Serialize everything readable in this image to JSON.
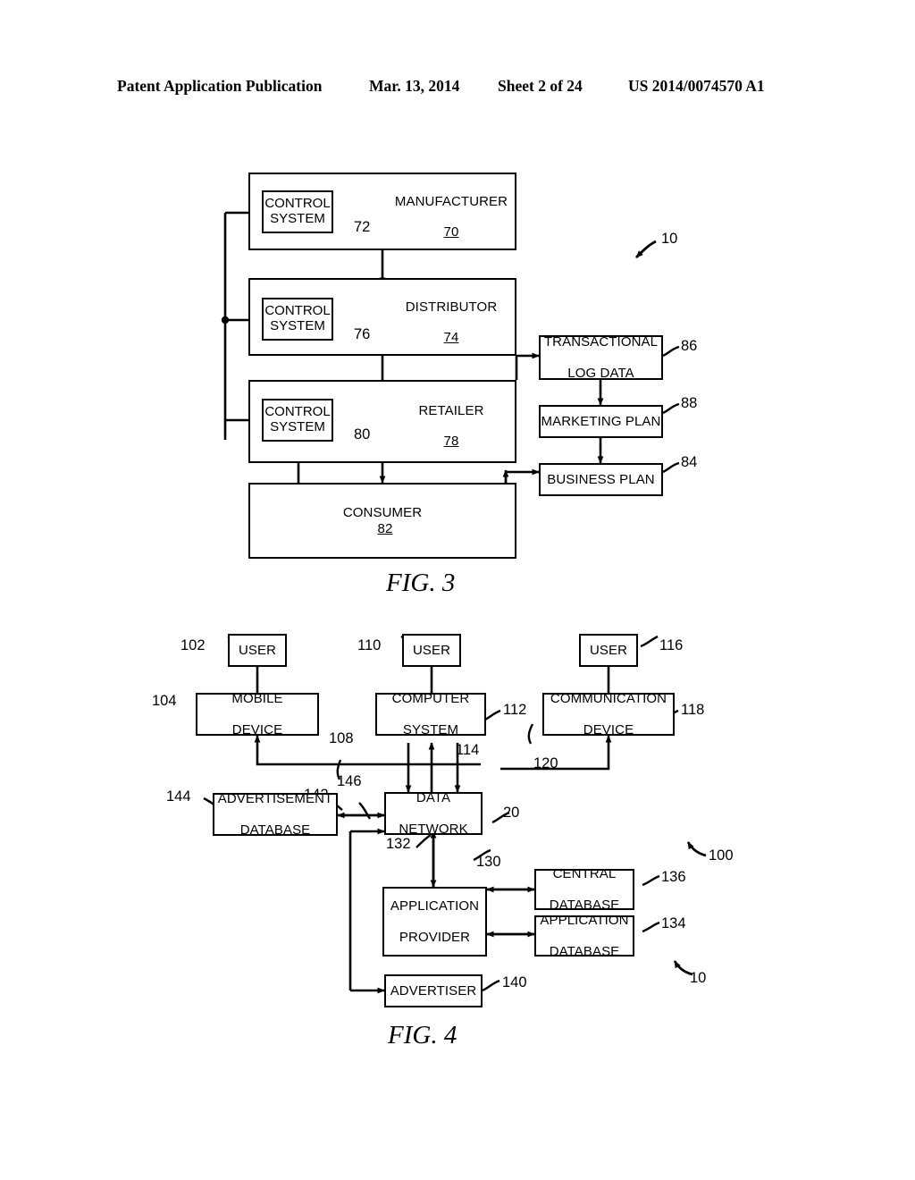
{
  "header": {
    "publication": "Patent Application Publication",
    "date": "Mar. 13, 2014",
    "sheet": "Sheet 2 of 24",
    "number": "US 2014/0074570 A1"
  },
  "fig3": {
    "caption": "FIG. 3",
    "system_ref": "10",
    "nodes": [
      {
        "id": "manufacturer",
        "label": "MANUFACTURER",
        "ref": "70"
      },
      {
        "id": "distributor",
        "label": "DISTRIBUTOR",
        "ref": "74"
      },
      {
        "id": "retailer",
        "label": "RETAILER",
        "ref": "78"
      },
      {
        "id": "consumer",
        "label": "CONSUMER",
        "ref": "82"
      }
    ],
    "control_systems": [
      {
        "id": "cs-manufacturer",
        "label": "CONTROL SYSTEM",
        "line1": "CONTROL",
        "line2": "SYSTEM",
        "ref": "72"
      },
      {
        "id": "cs-distributor",
        "label": "CONTROL SYSTEM",
        "line1": "CONTROL",
        "line2": "SYSTEM",
        "ref": "76"
      },
      {
        "id": "cs-retailer",
        "label": "CONTROL SYSTEM",
        "line1": "CONTROL",
        "line2": "SYSTEM",
        "ref": "80"
      }
    ],
    "side_nodes": [
      {
        "id": "transactional-log-data",
        "line1": "TRANSACTIONAL",
        "line2": "LOG DATA",
        "ref": "86"
      },
      {
        "id": "marketing-plan",
        "line1": "MARKETING PLAN",
        "line2": "",
        "ref": "88"
      },
      {
        "id": "business-plan",
        "line1": "BUSINESS PLAN",
        "line2": "",
        "ref": "84"
      }
    ]
  },
  "fig4": {
    "caption": "FIG. 4",
    "system_ref": "100",
    "alt_system_ref": "10",
    "users": [
      {
        "id": "user-mobile",
        "label": "USER",
        "ref": "102"
      },
      {
        "id": "user-computer",
        "label": "USER",
        "ref": "110"
      },
      {
        "id": "user-comm",
        "label": "USER",
        "ref": "116"
      }
    ],
    "devices": [
      {
        "id": "mobile-device",
        "line1": "MOBILE",
        "line2": "DEVICE",
        "ref": "104"
      },
      {
        "id": "computer-system",
        "line1": "COMPUTER",
        "line2": "SYSTEM",
        "ref": "112"
      },
      {
        "id": "communication-device",
        "line1": "COMMUNICATION",
        "line2": "DEVICE",
        "ref": "118"
      }
    ],
    "data_network": {
      "line1": "DATA",
      "line2": "NETWORK",
      "ref": "20"
    },
    "advertisement_database": {
      "line1": "ADVERTISEMENT",
      "line2": "DATABASE",
      "ref": "144"
    },
    "application_provider": {
      "line1": "APPLICATION",
      "line2": "PROVIDER",
      "ref": "130"
    },
    "central_database": {
      "line1": "CENTRAL",
      "line2": "DATABASE",
      "ref": "136"
    },
    "application_database": {
      "line1": "APPLICATION",
      "line2": "DATABASE",
      "ref": "134"
    },
    "advertiser": {
      "line1": "ADVERTISER",
      "line2": "",
      "ref": "140"
    },
    "link_refs": {
      "mobile_link": "108",
      "computer_link": "114",
      "comm_link": "120",
      "ad_db_link": "146",
      "provider_link": "132",
      "advertiser_link": "142"
    }
  }
}
